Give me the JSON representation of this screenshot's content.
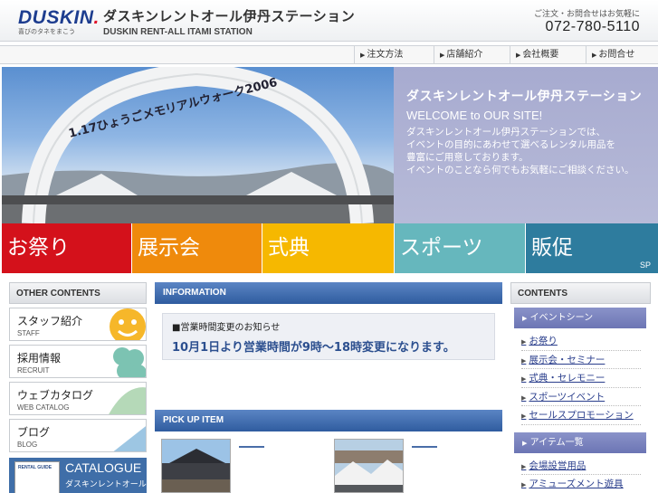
{
  "header": {
    "logo_text": "DUSKIN",
    "logo_tagline": "喜びのタネをまこう",
    "title_jp": "ダスキンレントオール伊丹ステーション",
    "title_en": "DUSKIN RENT-ALL ITAMI STATION",
    "contact_label": "ご注文・お問合せはお気軽に",
    "phone": "072-780-5110"
  },
  "topnav": [
    "注文方法",
    "店舗紹介",
    "会社概要",
    "お問合せ"
  ],
  "hero": {
    "arch_text": "1.17ひょうごメモリアルウォーク2006",
    "title": "ダスキンレントオール伊丹ステーション",
    "welcome": "WELCOME to OUR SITE!",
    "lines": [
      "ダスキンレントオール伊丹ステーションでは、",
      "イベントの目的にあわせて選べるレンタル用品を",
      "豊富にご用意しております。",
      "イベントのことなら何でもお気軽にご相談ください。"
    ]
  },
  "categories": [
    {
      "label": "お祭り",
      "sub": "",
      "color": "#d4111b"
    },
    {
      "label": "展示会",
      "sub": "",
      "color": "#ef8a0c"
    },
    {
      "label": "式典",
      "sub": "",
      "color": "#f6b800"
    },
    {
      "label": "スポーツ",
      "sub": "",
      "color": "#66b7bd"
    },
    {
      "label": "販促",
      "sub": "SP",
      "color": "#2e7c9e"
    }
  ],
  "left": {
    "heading": "OTHER CONTENTS",
    "buttons": [
      {
        "jp": "スタッフ紹介",
        "en": "STAFF"
      },
      {
        "jp": "採用情報",
        "en": "RECRUIT"
      },
      {
        "jp": "ウェブカタログ",
        "en": "WEB CATALOG"
      },
      {
        "jp": "ブログ",
        "en": "BLOG"
      }
    ],
    "catalogue_title": "CATALOGUE",
    "catalogue_sub": "ダスキンレントオール",
    "book_text": "RENTAL GUIDE"
  },
  "center": {
    "info_heading": "INFORMATION",
    "info_title": "■営業時間変更のお知らせ",
    "info_message": "10月1日より営業時間が9時～18時変更になります。",
    "pick_heading": "PICK UP ITEM"
  },
  "right": {
    "heading": "CONTENTS",
    "section1": "イベントシーン",
    "section1_items": [
      "お祭り",
      "展示会・セミナー",
      "式典・セレモニー",
      "スポーツイベント",
      "セールスプロモーション"
    ],
    "section2": "アイテム一覧",
    "section2_items": [
      "会場設営用品",
      "アミューズメント遊具"
    ]
  }
}
